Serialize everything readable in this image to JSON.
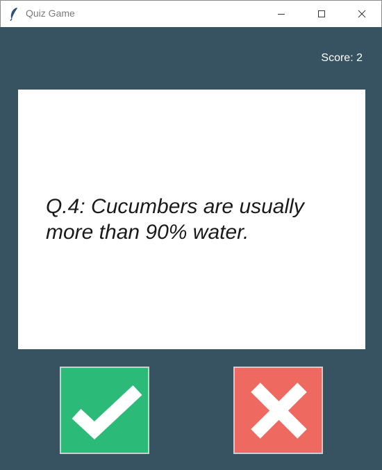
{
  "window": {
    "title": "Quiz Game",
    "controls": {
      "minimize": "minimize",
      "maximize": "maximize",
      "close": "close"
    }
  },
  "score": {
    "text": "Score: 2"
  },
  "question": {
    "text": "Q.4: Cucumbers are usually more than 90% water."
  },
  "buttons": {
    "true_icon": "checkmark-icon",
    "false_icon": "cross-icon"
  },
  "colors": {
    "background": "#375362",
    "card": "#ffffff",
    "true_button": "#2cba78",
    "false_button": "#ee6a60"
  }
}
